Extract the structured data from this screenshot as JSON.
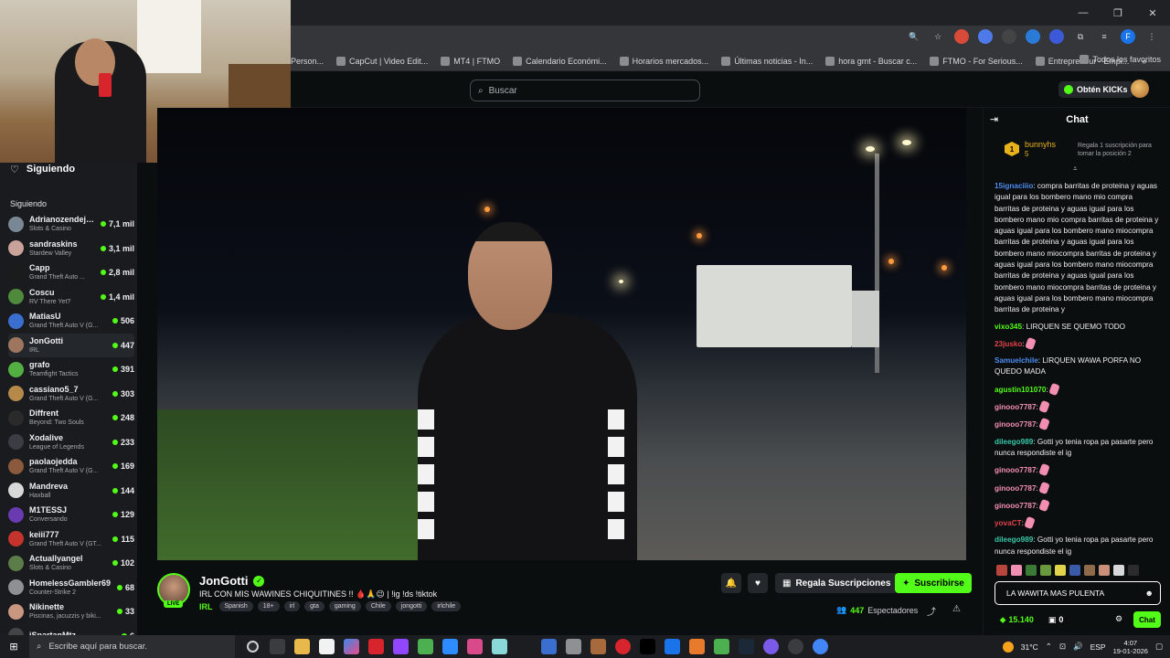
{
  "browser": {
    "bookmarks": [
      "Person...",
      "CapCut | Video Edit...",
      "MT4 | FTMO",
      "Calendario Económi...",
      "Horarios mercados...",
      "Últimas noticias - In...",
      "hora gmt - Buscar c...",
      "FTMO - For Serious...",
      "Entrepreneur - Empi..."
    ],
    "all_bookmarks": "Todos los favoritos",
    "profile_letter": "F"
  },
  "nav": {
    "search_placeholder": "Buscar",
    "get_kicks": "Obtén KICKs"
  },
  "sidebar": {
    "following_label": "Siguiendo",
    "section_title": "Siguiendo",
    "channels": [
      {
        "name": "Adrianozendeja...",
        "game": "Slots & Casino",
        "viewers": "7,1 mil",
        "color": "#7a8896"
      },
      {
        "name": "sandraskins",
        "game": "Stardew Valley",
        "viewers": "3,1 mil",
        "color": "#c9a39a"
      },
      {
        "name": "Capp",
        "game": "Grand Theft Auto ...",
        "viewers": "2,8 mil",
        "color": "#1b1b1b"
      },
      {
        "name": "Coscu",
        "game": "RV There Yet?",
        "viewers": "1,4 mil",
        "color": "#4f8a3c"
      },
      {
        "name": "MatiasU",
        "game": "Grand Theft Auto V (G...",
        "viewers": "506",
        "color": "#3a6fd0"
      },
      {
        "name": "JonGotti",
        "game": "IRL",
        "viewers": "447",
        "color": "#9e7660"
      },
      {
        "name": "grafo",
        "game": "Teamfight Tactics",
        "viewers": "391",
        "color": "#52b043"
      },
      {
        "name": "cassiano5_7",
        "game": "Grand Theft Auto V (G...",
        "viewers": "303",
        "color": "#b5894a"
      },
      {
        "name": "Diffrent",
        "game": "Beyond: Two Souls",
        "viewers": "248",
        "color": "#2a2a2a"
      },
      {
        "name": "Xodalive",
        "game": "League of Legends",
        "viewers": "233",
        "color": "#3c3c44"
      },
      {
        "name": "paolaojedda",
        "game": "Grand Theft Auto V (G...",
        "viewers": "169",
        "color": "#8b5a3c"
      },
      {
        "name": "Mandreva",
        "game": "Haxball",
        "viewers": "144",
        "color": "#d8d8d8"
      },
      {
        "name": "M1TESSJ",
        "game": "Conversando",
        "viewers": "129",
        "color": "#6a3ab0"
      },
      {
        "name": "keiii777",
        "game": "Grand Theft Auto V (GT...",
        "viewers": "115",
        "color": "#c4342c"
      },
      {
        "name": "Actuallyangel",
        "game": "Slots & Casino",
        "viewers": "102",
        "color": "#5c7c4a"
      },
      {
        "name": "HomelessGambler69",
        "game": "Counter-Strike 2",
        "viewers": "68",
        "color": "#8f9093"
      },
      {
        "name": "Nikinette",
        "game": "Piscinas, jacuzzis y biki...",
        "viewers": "33",
        "color": "#c99780"
      },
      {
        "name": "iSpartanMtz",
        "game": "",
        "viewers": "6",
        "color": "#444"
      }
    ]
  },
  "stream": {
    "streamer": "JonGotti",
    "live_badge": "LIVE",
    "title": "IRL CON MIS WAWINES CHIQUITINES !! 🩸🙏😉 | !ig !ds !tiktok",
    "category": "IRL",
    "tags": [
      "Spanish",
      "18+",
      "irl",
      "gta",
      "gaming",
      "Chile",
      "jongotti",
      "irlchile"
    ],
    "gift_label": "Regala Suscripciones",
    "subscribe_label": "Suscribirse",
    "viewers": "447",
    "viewers_label": "Espectadores"
  },
  "chat": {
    "header": "Chat",
    "pinned": {
      "user": "bunnyhs",
      "count": "5",
      "desc": "Regala 1 suscripción para tomar la posición 2"
    },
    "messages": [
      {
        "user": "15ignaciiio",
        "color": "#4d8cf0",
        "text": "compra barritas de proteina y aguas igual para los bombero mano mio compra barritas de proteina y aguas igual para los bombero mano mio compra barritas de proteina y aguas igual para los bombero mano miocompra barritas de proteina y aguas igual para los bombero mano miocompra barritas de proteina y aguas igual para los bombero mano miocompra barritas de proteina y aguas igual para los bombero mano miocompra barritas de proteina y aguas igual para los bombero mano miocompra barritas de proteina y"
      },
      {
        "user": "vixo345",
        "color": "#53fc18",
        "text": "LIRQUEN SE QUEMO TODO"
      },
      {
        "user": "23jusko",
        "color": "#e0424a",
        "text": "",
        "emote": true
      },
      {
        "user": "Samuelchile",
        "color": "#4d8cf0",
        "text": "LIRQUEN WAWA PORFA NO QUEDO MADA"
      },
      {
        "user": "agustin101070",
        "color": "#53fc18",
        "text": "",
        "emote": true
      },
      {
        "user": "ginooo7787",
        "color": "#f28fb0",
        "text": "",
        "emote": true
      },
      {
        "user": "ginooo7787",
        "color": "#f28fb0",
        "text": "",
        "emote": true
      },
      {
        "user": "dileego989",
        "color": "#38c8a8",
        "text": "Gotti yo tenia ropa pa pasarte pero nunca respondiste el ig"
      },
      {
        "user": "ginooo7787",
        "color": "#f28fb0",
        "text": "",
        "emote": true
      },
      {
        "user": "ginooo7787",
        "color": "#f28fb0",
        "text": "",
        "emote": true
      },
      {
        "user": "ginooo7787",
        "color": "#f28fb0",
        "text": "",
        "emote": true
      },
      {
        "user": "yovaCT",
        "color": "#e0424a",
        "text": "",
        "emote": true
      },
      {
        "user": "dileego989",
        "color": "#38c8a8",
        "text": "Gotti yo tenia ropa pa pasarte pero nunca respondiste el ig"
      }
    ],
    "input_value": "LA WAWITA MAS PULENTA",
    "kick_points": "15.140",
    "sub_count": "0",
    "send_label": "Chat"
  },
  "taskbar": {
    "search_placeholder": "Escribe aquí para buscar.",
    "temperature": "31°C",
    "language": "ESP",
    "time": "4:07",
    "date": "19-01-2026"
  }
}
